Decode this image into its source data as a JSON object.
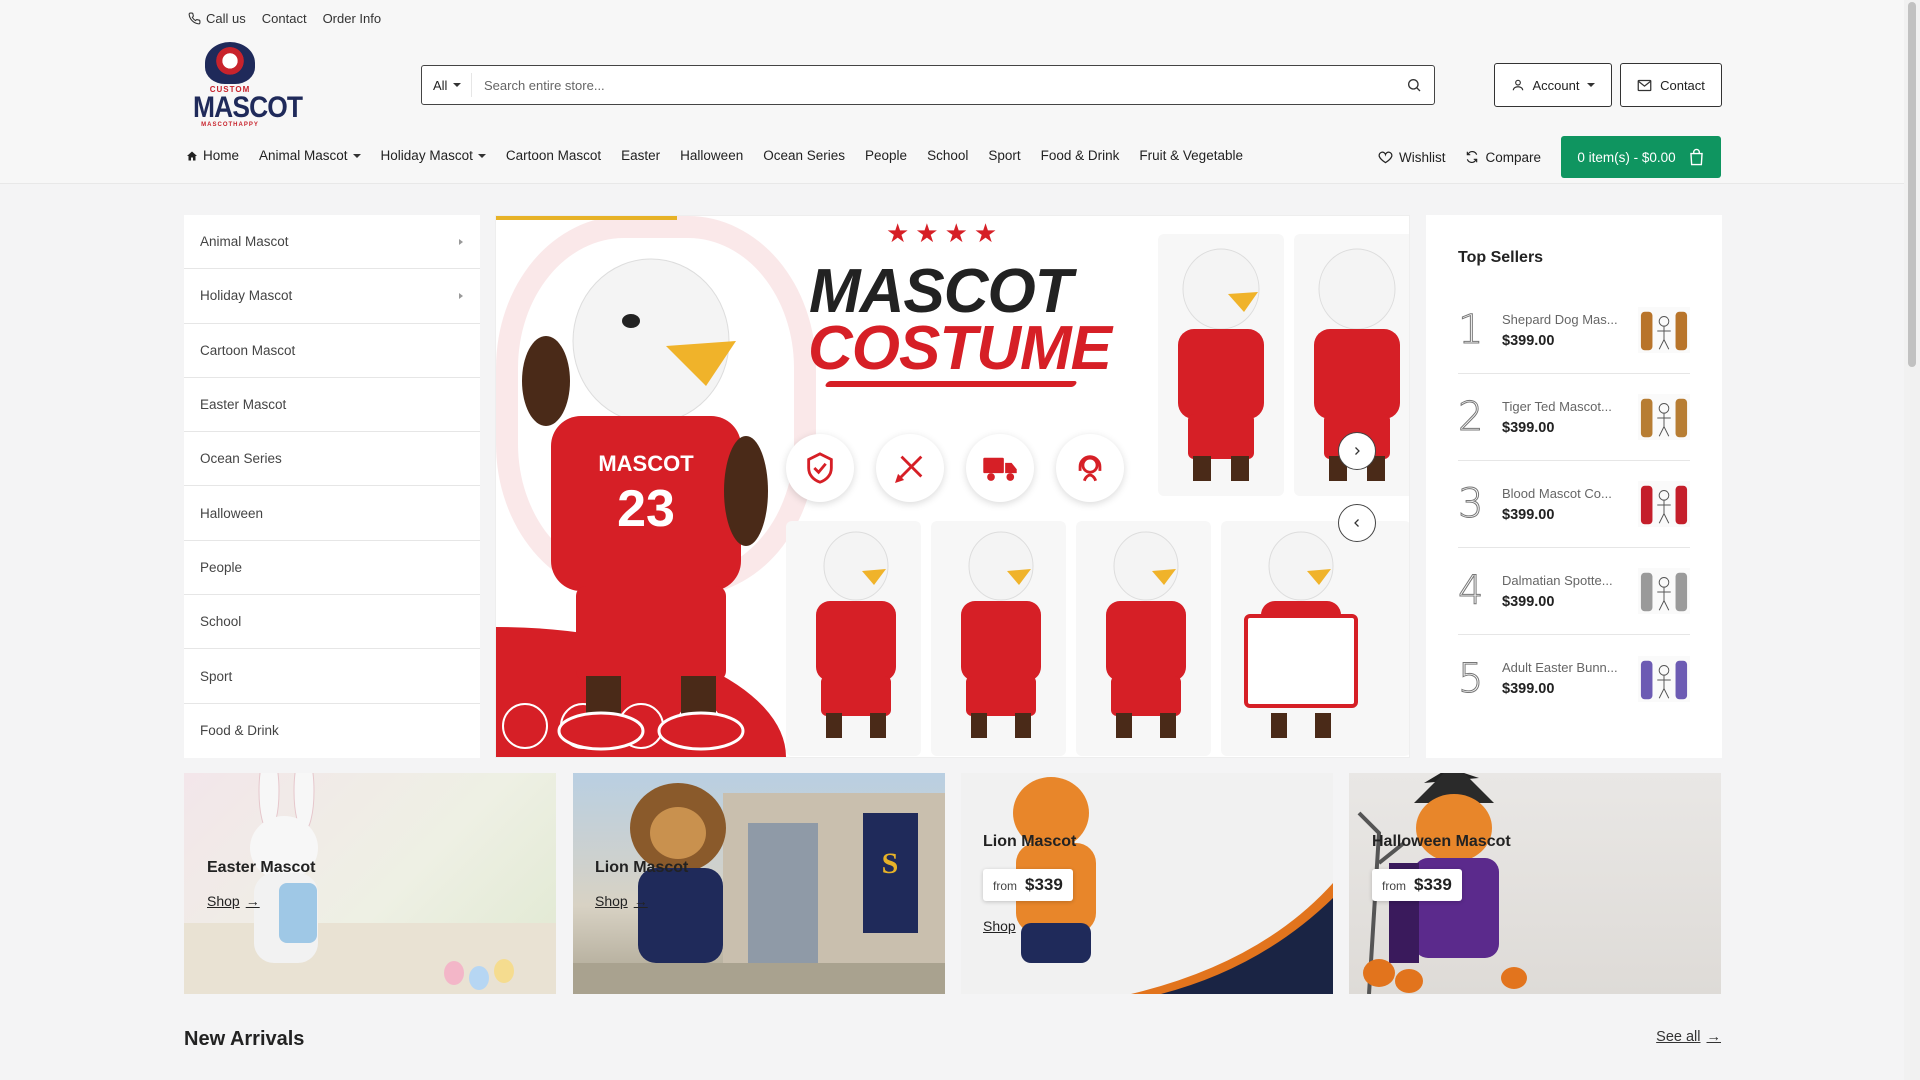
{
  "topbar": {
    "call_us": "Call us",
    "contact": "Contact",
    "order_info": "Order Info"
  },
  "logo": {
    "top": "CUSTOM",
    "main": "MASCOT",
    "tag": "MASCOTHAPPY"
  },
  "search": {
    "category": "All",
    "placeholder": "Search entire store..."
  },
  "header_buttons": {
    "account": "Account",
    "contact": "Contact"
  },
  "nav": {
    "items": [
      "Home",
      "Animal Mascot",
      "Holiday Mascot",
      "Cartoon Mascot",
      "Easter",
      "Halloween",
      "Ocean Series",
      "People",
      "School",
      "Sport",
      "Food & Drink",
      "Fruit & Vegetable"
    ],
    "wishlist": "Wishlist",
    "compare": "Compare",
    "cart": "0 item(s) - $0.00"
  },
  "categories": [
    {
      "label": "Animal Mascot",
      "has_sub": true
    },
    {
      "label": "Holiday Mascot",
      "has_sub": true
    },
    {
      "label": "Cartoon Mascot",
      "has_sub": false
    },
    {
      "label": "Easter Mascot",
      "has_sub": false
    },
    {
      "label": "Ocean Series",
      "has_sub": false
    },
    {
      "label": "Halloween",
      "has_sub": false
    },
    {
      "label": "People",
      "has_sub": false
    },
    {
      "label": "School",
      "has_sub": false
    },
    {
      "label": "Sport",
      "has_sub": false
    },
    {
      "label": "Food & Drink",
      "has_sub": false
    }
  ],
  "hero": {
    "title_line1": "MASCOT",
    "title_line2": "COSTUME",
    "jersey": "MASCOT",
    "jersey_number": "23"
  },
  "top_sellers": {
    "title": "Top Sellers",
    "items": [
      {
        "rank": "1",
        "name": "Shepard Dog Mas...",
        "price": "$399.00",
        "color": "#b8742a"
      },
      {
        "rank": "2",
        "name": "Tiger Ted Mascot...",
        "price": "$399.00",
        "color": "#b77d33"
      },
      {
        "rank": "3",
        "name": "Blood Mascot Co...",
        "price": "$399.00",
        "color": "#c41e2a"
      },
      {
        "rank": "4",
        "name": "Dalmatian Spotte...",
        "price": "$399.00",
        "color": "#9a9a9a"
      },
      {
        "rank": "5",
        "name": "Adult Easter Bunn...",
        "price": "$399.00",
        "color": "#6c5bb3"
      }
    ]
  },
  "banners": [
    {
      "title": "Easter Mascot",
      "shop": "Shop",
      "from": "",
      "price": ""
    },
    {
      "title": "Lion Mascot",
      "shop": "Shop",
      "from": "",
      "price": ""
    },
    {
      "title": "Lion Mascot",
      "shop": "Shop",
      "from": "from",
      "price": "$339"
    },
    {
      "title": "Halloween Mascot",
      "shop": "",
      "from": "from",
      "price": "$339"
    }
  ],
  "new_arrivals": {
    "title": "New Arrivals",
    "see_all": "See all"
  },
  "colors": {
    "accent_green": "#0f9560",
    "brand_red": "#d61f26",
    "navy": "#1f2a5a",
    "progress": "#e7b227"
  }
}
